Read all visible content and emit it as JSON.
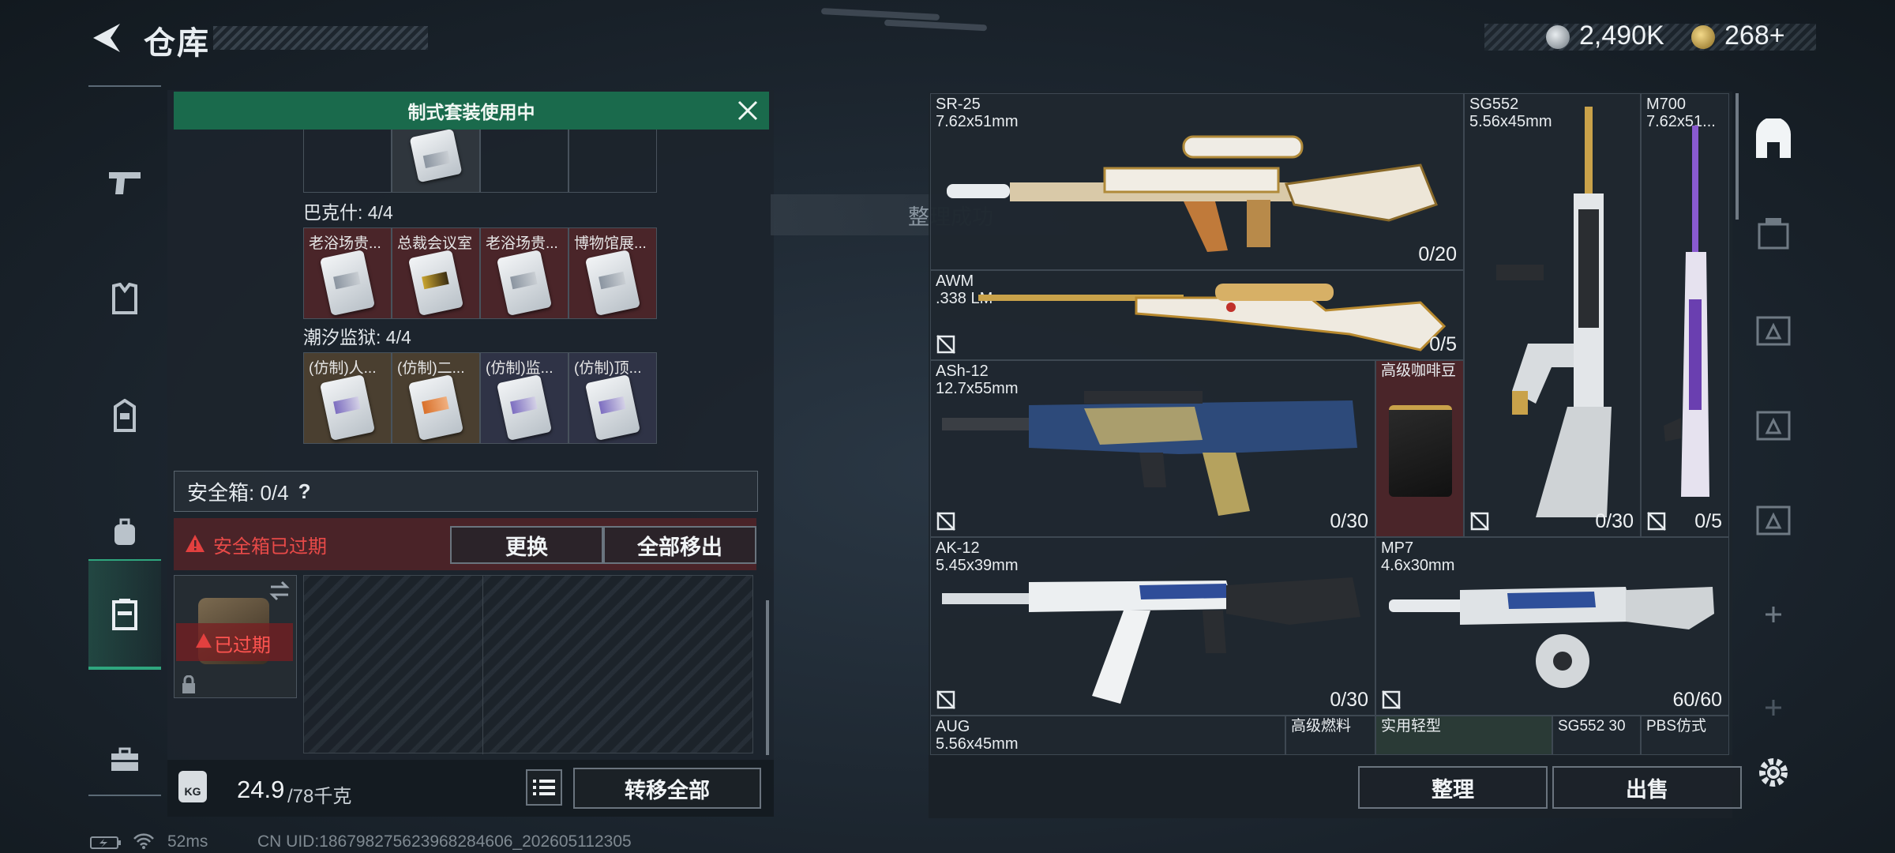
{
  "header": {
    "title": "仓库",
    "currency_1": "2,490K",
    "currency_2": "268+"
  },
  "left_panel": {
    "banner": "制式套装使用中",
    "set_1_label": "巴克什: 4/4",
    "set_1_items": [
      "老浴场贵...",
      "总裁会议室",
      "老浴场贵...",
      "博物馆展..."
    ],
    "set_2_label": "潮汐监狱: 4/4",
    "set_2_items": [
      "(仿制)人...",
      "(仿制)二...",
      "(仿制)监...",
      "(仿制)顶..."
    ],
    "safe_box": "安全箱: 0/4",
    "help": "?",
    "expired_notice": "安全箱已过期",
    "replace_button": "更换",
    "remove_all_button": "全部移出",
    "expired_tag": "已过期",
    "weight_value": "24.9",
    "weight_max": "/78千克",
    "kg_icon_text": "KG",
    "transfer_all_button": "转移全部"
  },
  "toast": "整理成功",
  "weapons": [
    {
      "name": "SR-25",
      "caliber": "7.62x51mm",
      "count": "0/20"
    },
    {
      "name": "AWM",
      "caliber": ".338 LM",
      "count": "0/5"
    },
    {
      "name": "ASh-12",
      "caliber": "12.7x55mm",
      "count": "0/30"
    },
    {
      "name": "AK-12",
      "caliber": "5.45x39mm",
      "count": "0/30"
    },
    {
      "name": "AUG",
      "caliber": "5.56x45mm",
      "count": ""
    },
    {
      "name": "SG552",
      "caliber": "5.56x45mm",
      "count": "0/30"
    },
    {
      "name": "M700",
      "caliber": "7.62x51...",
      "count": "0/5"
    },
    {
      "name": "MP7",
      "caliber": "4.6x30mm",
      "count": "60/60"
    }
  ],
  "items": {
    "coffee": "高级咖啡豆",
    "fuel": "高级燃料",
    "light": "实用轻型",
    "sg552_pbs": "SG552 30",
    "pbs_style": "PBS仿式"
  },
  "right_buttons": {
    "sort": "整理",
    "sell": "出售"
  },
  "status_bar": {
    "ping": "52ms",
    "uid": "CN UID:186798275623968284606_202605112305"
  }
}
